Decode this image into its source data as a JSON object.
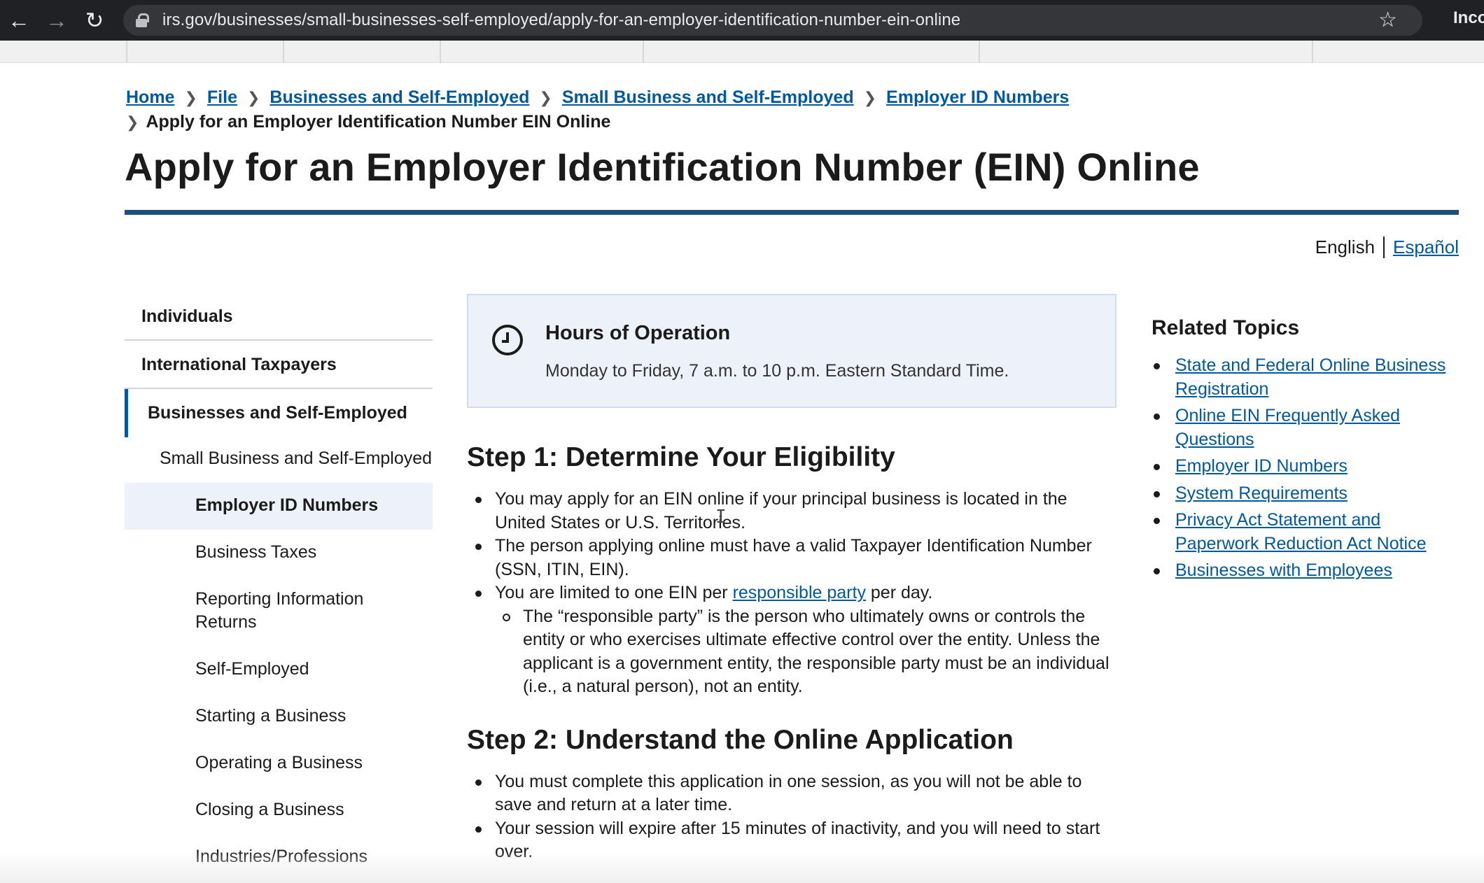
{
  "browser": {
    "url": "irs.gov/businesses/small-businesses-self-employed/apply-for-an-employer-identification-number-ein-online",
    "profile_label": "Inco"
  },
  "breadcrumb": {
    "items": [
      "Home",
      "File",
      "Businesses and Self-Employed",
      "Small Business and Self-Employed",
      "Employer ID Numbers"
    ],
    "current": "Apply for an Employer Identification Number EIN Online"
  },
  "page": {
    "title": "Apply for an Employer Identification Number (EIN) Online"
  },
  "language": {
    "current": "English",
    "alternate": "Español"
  },
  "sidenav": {
    "top_items": [
      "Individuals",
      "International Taxpayers"
    ],
    "active": "Businesses and Self-Employed",
    "sub": "Small Business and Self-Employed",
    "current": "Employer ID Numbers",
    "children": [
      "Business Taxes",
      "Reporting Information Returns",
      "Self-Employed",
      "Starting a Business",
      "Operating a Business",
      "Closing a Business",
      "Industries/Professions"
    ]
  },
  "hours": {
    "title": "Hours of Operation",
    "text": "Monday to Friday, 7 a.m. to 10 p.m. Eastern Standard Time."
  },
  "step1": {
    "heading": "Step 1: Determine Your Eligibility",
    "bullet1": "You may apply for an EIN online if your principal business is located in the United States or U.S. Territories.",
    "bullet2": "The person applying online must have a valid Taxpayer Identification Number (SSN, ITIN, EIN).",
    "bullet3_before": "You are limited to one EIN per ",
    "bullet3_link": "responsible party",
    "bullet3_after": " per day.",
    "sub_bullet": "The “responsible party” is the person who ultimately owns or controls the entity or who exercises ultimate effective control over the entity. Unless the applicant is a government entity, the responsible party must be an individual (i.e., a natural person), not an entity."
  },
  "step2": {
    "heading": "Step 2: Understand the Online Application",
    "bullet1": "You must complete this application in one session, as you will not be able to save and return at a later time.",
    "bullet2": "Your session will expire after 15 minutes of inactivity, and you will need to start over."
  },
  "related": {
    "title": "Related Topics",
    "links": [
      "State and Federal Online Business Registration",
      "Online EIN Frequently Asked Questions",
      "Employer ID Numbers",
      "System Requirements",
      "Privacy Act Statement and Paperwork Reduction Act Notice",
      "Businesses with Employees"
    ]
  }
}
